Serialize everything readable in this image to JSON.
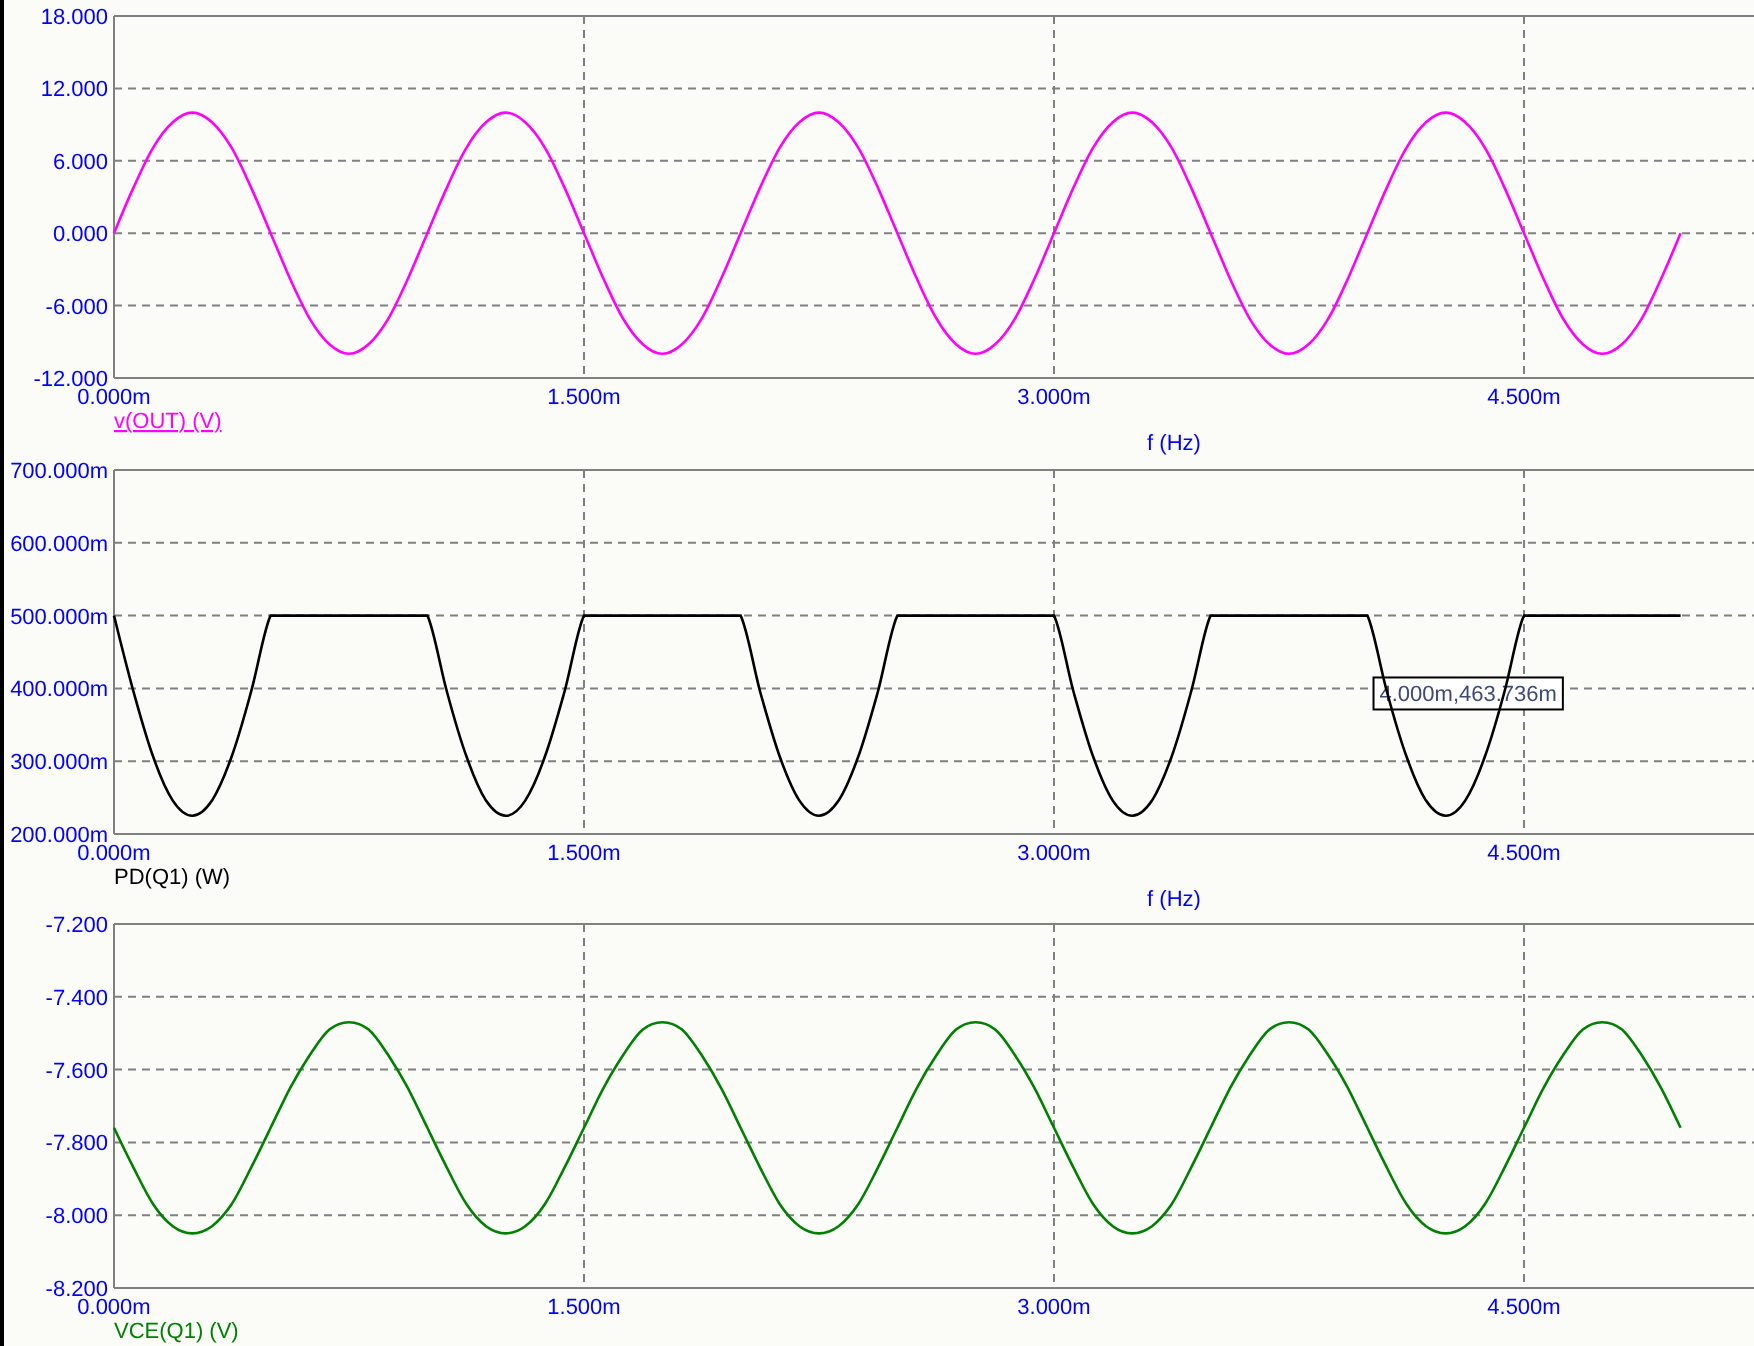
{
  "charts": [
    {
      "trace_selected": true,
      "chart_data": {
        "type": "line",
        "xlabel": "f (Hz)",
        "grid": true,
        "xlim": [
          0,
          5.234
        ],
        "ylim": [
          -12,
          18
        ],
        "xticks": [
          {
            "value": 0,
            "label": "0.000m"
          },
          {
            "value": 1.5,
            "label": "1.500m"
          },
          {
            "value": 3,
            "label": "3.000m"
          },
          {
            "value": 4.5,
            "label": "4.500m"
          }
        ],
        "yticks": [
          {
            "value": 18,
            "label": "18.000"
          },
          {
            "value": 12,
            "label": "12.000"
          },
          {
            "value": 6,
            "label": "6.000"
          },
          {
            "value": 0,
            "label": "0.000"
          },
          {
            "value": -6,
            "label": "-6.000"
          },
          {
            "value": -12,
            "label": "-12.000"
          }
        ],
        "x": [
          0,
          0.0625,
          0.125,
          0.1875,
          0.25,
          0.3125,
          0.375,
          0.4375,
          0.5,
          0.5625,
          0.625,
          0.6875,
          0.75,
          0.8125,
          0.875,
          0.9375,
          1,
          1.0625,
          1.125,
          1.1875,
          1.25,
          1.3125,
          1.375,
          1.4375,
          1.5,
          1.5625,
          1.625,
          1.6875,
          1.75,
          1.8125,
          1.875,
          1.9375,
          2,
          2.0625,
          2.125,
          2.1875,
          2.25,
          2.3125,
          2.375,
          2.4375,
          2.5,
          2.5625,
          2.625,
          2.6875,
          2.75,
          2.8125,
          2.875,
          2.9375,
          3,
          3.0625,
          3.125,
          3.1875,
          3.25,
          3.3125,
          3.375,
          3.4375,
          3.5,
          3.5625,
          3.625,
          3.6875,
          3.75,
          3.8125,
          3.875,
          3.9375,
          4,
          4.0625,
          4.125,
          4.1875,
          4.25,
          4.3125,
          4.375,
          4.4375,
          4.5,
          4.5625,
          4.625,
          4.6875,
          4.75,
          4.8125,
          4.875,
          4.9375,
          5
        ],
        "series": [
          {
            "name": "v(OUT) (V)",
            "color": "#ff00ff",
            "values": [
              0,
              3.8,
              7.1,
              9.2,
              10,
              9.2,
              7.1,
              3.8,
              0,
              -3.8,
              -7.1,
              -9.2,
              -10,
              -9.2,
              -7.1,
              -3.8,
              0,
              3.8,
              7.1,
              9.2,
              10,
              9.2,
              7.1,
              3.8,
              0,
              -3.8,
              -7.1,
              -9.2,
              -10,
              -9.2,
              -7.1,
              -3.8,
              0,
              3.8,
              7.1,
              9.2,
              10,
              9.2,
              7.1,
              3.8,
              0,
              -3.8,
              -7.1,
              -9.2,
              -10,
              -9.2,
              -7.1,
              -3.8,
              0,
              3.8,
              7.1,
              9.2,
              10,
              9.2,
              7.1,
              3.8,
              0,
              -3.8,
              -7.1,
              -9.2,
              -10,
              -9.2,
              -7.1,
              -3.8,
              0,
              3.8,
              7.1,
              9.2,
              10,
              9.2,
              7.1,
              3.8,
              0,
              -3.8,
              -7.1,
              -9.2,
              -10,
              -9.2,
              -7.1,
              -3.8,
              0
            ]
          }
        ]
      }
    },
    {
      "trace_selected": false,
      "chart_data": {
        "type": "line",
        "xlabel": "f (Hz)",
        "grid": true,
        "xlim": [
          0,
          5.234
        ],
        "ylim": [
          200,
          700
        ],
        "xticks": [
          {
            "value": 0,
            "label": "0.000m"
          },
          {
            "value": 1.5,
            "label": "1.500m"
          },
          {
            "value": 3,
            "label": "3.000m"
          },
          {
            "value": 4.5,
            "label": "4.500m"
          }
        ],
        "yticks": [
          {
            "value": 700,
            "label": "700.000m"
          },
          {
            "value": 600,
            "label": "600.000m"
          },
          {
            "value": 500,
            "label": "500.000m"
          },
          {
            "value": 400,
            "label": "400.000m"
          },
          {
            "value": 300,
            "label": "300.000m"
          },
          {
            "value": 200,
            "label": "200.000m"
          }
        ],
        "x": [
          0,
          0.0625,
          0.125,
          0.1875,
          0.25,
          0.3125,
          0.375,
          0.4375,
          0.5,
          0.5625,
          0.625,
          0.6875,
          0.75,
          0.8125,
          0.875,
          0.9375,
          1,
          1.0625,
          1.125,
          1.1875,
          1.25,
          1.3125,
          1.375,
          1.4375,
          1.5,
          1.5625,
          1.625,
          1.6875,
          1.75,
          1.8125,
          1.875,
          1.9375,
          2,
          2.0625,
          2.125,
          2.1875,
          2.25,
          2.3125,
          2.375,
          2.4375,
          2.5,
          2.5625,
          2.625,
          2.6875,
          2.75,
          2.8125,
          2.875,
          2.9375,
          3,
          3.0625,
          3.125,
          3.1875,
          3.25,
          3.3125,
          3.375,
          3.4375,
          3.5,
          3.5625,
          3.625,
          3.6875,
          3.75,
          3.8125,
          3.875,
          3.9375,
          4,
          4.0625,
          4.125,
          4.1875,
          4.25,
          4.3125,
          4.375,
          4.4375,
          4.5,
          4.5625,
          4.625,
          4.6875,
          4.75,
          4.8125,
          4.875,
          4.9375,
          5
        ],
        "series": [
          {
            "name": "PD(Q1) (W)",
            "color": "#000000",
            "values": [
              500,
              395,
              306,
              246,
              225,
              246,
              306,
              395,
              500,
              500,
              500,
              500,
              500,
              500,
              500,
              500,
              500,
              395,
              306,
              246,
              225,
              246,
              306,
              395,
              500,
              500,
              500,
              500,
              500,
              500,
              500,
              500,
              500,
              395,
              306,
              246,
              225,
              246,
              306,
              395,
              500,
              500,
              500,
              500,
              500,
              500,
              500,
              500,
              500,
              395,
              306,
              246,
              225,
              246,
              306,
              395,
              500,
              500,
              500,
              500,
              500,
              500,
              500,
              500,
              500,
              395,
              306,
              246,
              225,
              246,
              306,
              395,
              500,
              500,
              500,
              500,
              500,
              500,
              500,
              500,
              500
            ]
          }
        ],
        "annotations": [
          "4.000m,463.736m"
        ]
      }
    },
    {
      "trace_selected": false,
      "chart_data": {
        "type": "line",
        "grid": true,
        "xlim": [
          0,
          5.234
        ],
        "ylim": [
          -8.2,
          -7.2
        ],
        "xticks": [
          {
            "value": 0,
            "label": "0.000m"
          },
          {
            "value": 1.5,
            "label": "1.500m"
          },
          {
            "value": 3,
            "label": "3.000m"
          },
          {
            "value": 4.5,
            "label": "4.500m"
          }
        ],
        "yticks": [
          {
            "value": -7.2,
            "label": "-7.200"
          },
          {
            "value": -7.4,
            "label": "-7.400"
          },
          {
            "value": -7.6,
            "label": "-7.600"
          },
          {
            "value": -7.8,
            "label": "-7.800"
          },
          {
            "value": -8,
            "label": "-8.000"
          },
          {
            "value": -8.2,
            "label": "-8.200"
          }
        ],
        "x": [
          0,
          0.0625,
          0.125,
          0.1875,
          0.25,
          0.3125,
          0.375,
          0.4375,
          0.5,
          0.5625,
          0.625,
          0.6875,
          0.75,
          0.8125,
          0.875,
          0.9375,
          1,
          1.0625,
          1.125,
          1.1875,
          1.25,
          1.3125,
          1.375,
          1.4375,
          1.5,
          1.5625,
          1.625,
          1.6875,
          1.75,
          1.8125,
          1.875,
          1.9375,
          2,
          2.0625,
          2.125,
          2.1875,
          2.25,
          2.3125,
          2.375,
          2.4375,
          2.5,
          2.5625,
          2.625,
          2.6875,
          2.75,
          2.8125,
          2.875,
          2.9375,
          3,
          3.0625,
          3.125,
          3.1875,
          3.25,
          3.3125,
          3.375,
          3.4375,
          3.5,
          3.5625,
          3.625,
          3.6875,
          3.75,
          3.8125,
          3.875,
          3.9375,
          4,
          4.0625,
          4.125,
          4.1875,
          4.25,
          4.3125,
          4.375,
          4.4375,
          4.5,
          4.5625,
          4.625,
          4.6875,
          4.75,
          4.8125,
          4.875,
          4.9375,
          5
        ],
        "series": [
          {
            "name": "VCE(Q1) (V)",
            "color": "#008000",
            "values": [
              -7.76,
              -7.87,
              -7.97,
              -8.03,
              -8.05,
              -8.03,
              -7.97,
              -7.87,
              -7.76,
              -7.65,
              -7.56,
              -7.49,
              -7.47,
              -7.49,
              -7.56,
              -7.65,
              -7.76,
              -7.87,
              -7.97,
              -8.03,
              -8.05,
              -8.03,
              -7.97,
              -7.87,
              -7.76,
              -7.65,
              -7.56,
              -7.49,
              -7.47,
              -7.49,
              -7.56,
              -7.65,
              -7.76,
              -7.87,
              -7.97,
              -8.03,
              -8.05,
              -8.03,
              -7.97,
              -7.87,
              -7.76,
              -7.65,
              -7.56,
              -7.49,
              -7.47,
              -7.49,
              -7.56,
              -7.65,
              -7.76,
              -7.87,
              -7.97,
              -8.03,
              -8.05,
              -8.03,
              -7.97,
              -7.87,
              -7.76,
              -7.65,
              -7.56,
              -7.49,
              -7.47,
              -7.49,
              -7.56,
              -7.65,
              -7.76,
              -7.87,
              -7.97,
              -8.03,
              -8.05,
              -8.03,
              -7.97,
              -7.87,
              -7.76,
              -7.65,
              -7.56,
              -7.49,
              -7.47,
              -7.49,
              -7.56,
              -7.65,
              -7.76
            ]
          }
        ]
      }
    }
  ]
}
